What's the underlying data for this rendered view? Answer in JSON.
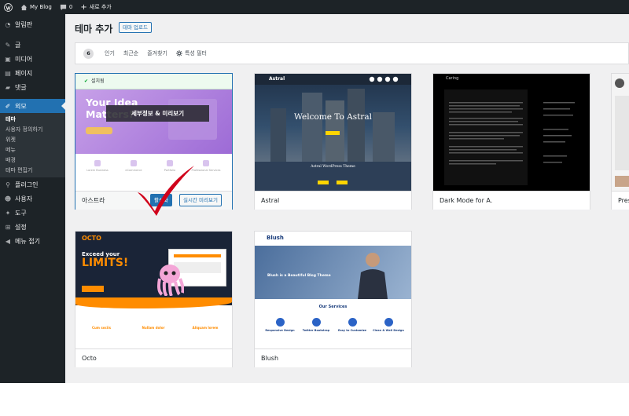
{
  "admin_bar": {
    "site_name": "My Blog",
    "comments_count": "0",
    "new_label": "새로 추가"
  },
  "sidebar": {
    "items": [
      {
        "label": "알림판",
        "icon": "dashboard-icon"
      },
      {
        "label": "글",
        "icon": "pin-icon"
      },
      {
        "label": "미디어",
        "icon": "media-icon"
      },
      {
        "label": "페이지",
        "icon": "page-icon"
      },
      {
        "label": "댓글",
        "icon": "comment-icon"
      },
      {
        "label": "외모",
        "icon": "brush-icon"
      },
      {
        "label": "플러그인",
        "icon": "plugin-icon"
      },
      {
        "label": "사용자",
        "icon": "user-icon"
      },
      {
        "label": "도구",
        "icon": "wrench-icon"
      },
      {
        "label": "설정",
        "icon": "settings-icon"
      },
      {
        "label": "메뉴 접기",
        "icon": "collapse-icon"
      }
    ],
    "submenu": [
      "테마",
      "사용자 정의하기",
      "위젯",
      "메뉴",
      "배경",
      "테마 편집기"
    ]
  },
  "header": {
    "title": "테마 추가",
    "upload_label": "테마 업로드"
  },
  "filter": {
    "count": "6",
    "tabs": [
      "인기",
      "최근순",
      "즐겨찾기"
    ],
    "feature_label": "특성 필터"
  },
  "themes": [
    {
      "name": "아스트라",
      "installed_label": "설치됨",
      "details_label": "세부정보 & 미리보기",
      "activate_label": "활성화",
      "preview_label": "실시간 미리보기",
      "shot": {
        "headline": "Your Idea Matters!",
        "features": [
          "Lorem Business",
          "eCommerce",
          "Portfolio",
          "Professional Services"
        ]
      }
    },
    {
      "name": "Astral",
      "shot": {
        "logo": "Astral",
        "headline": "Welcome To Astral",
        "subtitle": "Astral WordPress Theme"
      }
    },
    {
      "name": "Dark Mode for A.",
      "shot": {
        "logo": "Caring"
      }
    },
    {
      "name": "Pres"
    },
    {
      "name": "Octo",
      "shot": {
        "logo": "OCTO",
        "line1": "Exceed your",
        "line2": "LIMITS!",
        "cols": [
          "Cum sociis",
          "Nullam dolor",
          "Aliquam lorem"
        ]
      }
    },
    {
      "name": "Blush",
      "shot": {
        "logo": "Blush",
        "headline": "Blush is a Beautiful Blog Theme",
        "services_title": "Our Services",
        "services": [
          "Responsive Design",
          "Twitter Bootstrap",
          "Easy to Customize",
          "Clean & Well Design"
        ]
      }
    }
  ],
  "colors": {
    "accent": "#2271b1",
    "adminbar": "#1d2327",
    "check_mark": "#d0021b"
  }
}
